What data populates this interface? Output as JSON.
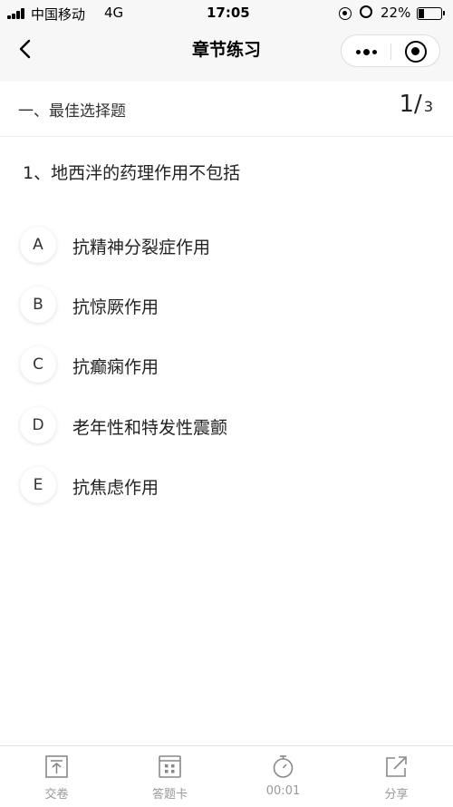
{
  "status_bar": {
    "carrier": "中国移动",
    "network": "4G",
    "time": "17:05",
    "battery_percent_label": "22%",
    "battery_level": 0.22
  },
  "nav": {
    "title": "章节练习"
  },
  "section": {
    "title": "一、最佳选择题",
    "current": "1",
    "separator": "/",
    "total": "3"
  },
  "question": {
    "text": "1、地西泮的药理作用不包括",
    "options": [
      {
        "letter": "A",
        "text": "抗精神分裂症作用"
      },
      {
        "letter": "B",
        "text": "抗惊厥作用"
      },
      {
        "letter": "C",
        "text": "抗癫痫作用"
      },
      {
        "letter": "D",
        "text": "老年性和特发性震颤"
      },
      {
        "letter": "E",
        "text": "抗焦虑作用"
      }
    ]
  },
  "tabbar": {
    "items": [
      {
        "label": "交卷",
        "icon": "submit-icon"
      },
      {
        "label": "答题卡",
        "icon": "answer-card-icon"
      },
      {
        "label": "00:01",
        "icon": "stopwatch-icon"
      },
      {
        "label": "分享",
        "icon": "share-icon"
      }
    ]
  }
}
